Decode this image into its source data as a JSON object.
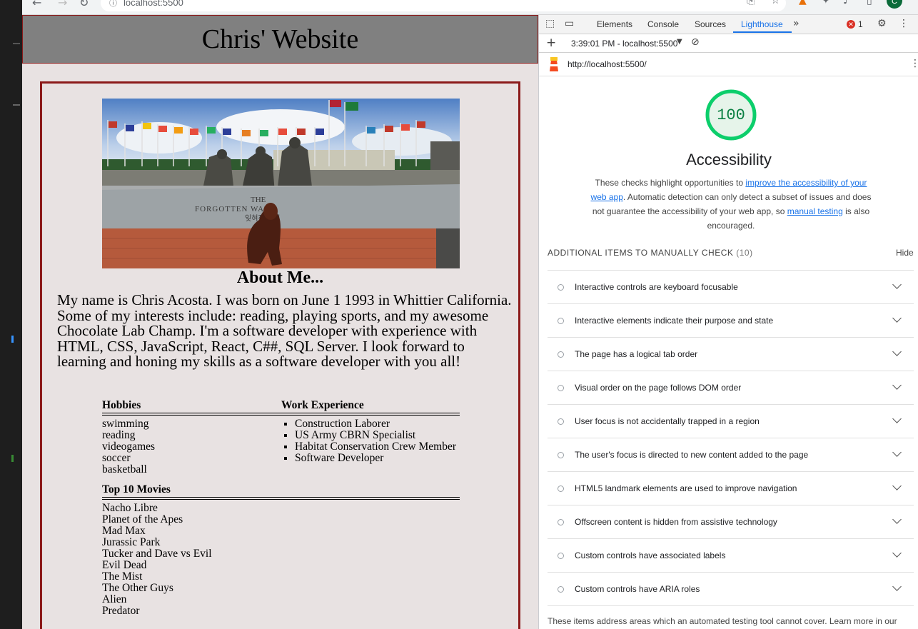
{
  "browser": {
    "address": "localhost:5500",
    "profile_initial": "C"
  },
  "site": {
    "header_title": "Chris' Website",
    "photo": {
      "inscription_line1": "THE",
      "inscription_line2": "FORGOTTEN WAR",
      "inscription_line3": "잊혀진 전쟁"
    },
    "about_title": "About Me...",
    "bio": "My name is Chris Acosta. I was born on June 1 1993 in Whittier California. Some of my interests include: reading, playing sports, and my awesome Chocolate Lab Champ. I'm a software developer with experience with HTML, CSS, JavaScript, React, C##, SQL Server. I look forward to learning and honing my skills as a software developer with you all!",
    "hobbies_title": "Hobbies",
    "hobbies": [
      "swimming",
      "reading",
      "videogames",
      "soccer",
      "basketball"
    ],
    "work_title": "Work Experience",
    "work": [
      "Construction Laborer",
      "US Army CBRN Specialist",
      "Habitat Conservation Crew Member",
      "Software Developer"
    ],
    "movies_title": "Top 10 Movies",
    "movies": [
      "Nacho Libre",
      "Planet of the Apes",
      "Mad Max",
      "Jurassic Park",
      "Tucker and Dave vs Evil",
      "Evil Dead",
      "The Mist",
      "The Other Guys",
      "Alien",
      "Predator"
    ]
  },
  "devtools": {
    "tabs": {
      "elements": "Elements",
      "console": "Console",
      "sources": "Sources",
      "lighthouse": "Lighthouse"
    },
    "error_count": "1",
    "report_select": "3:39:01 PM - localhost:5500",
    "report_url": "http://localhost:5500/",
    "score": "100",
    "score_fraction": 1.0,
    "score_color": "#0cce6b",
    "category_title": "Accessibility",
    "desc": {
      "part1": "These checks highlight opportunities to ",
      "link1": "improve the accessibility of your web app",
      "part2": ". Automatic detection can only detect a subset of issues and does not guarantee the accessibility of your web app, so ",
      "link2": "manual testing",
      "part3": " is also encouraged."
    },
    "manual_heading": "ADDITIONAL ITEMS TO MANUALLY CHECK",
    "manual_count": "(10)",
    "hide_label": "Hide",
    "audits": [
      "Interactive controls are keyboard focusable",
      "Interactive elements indicate their purpose and state",
      "The page has a logical tab order",
      "Visual order on the page follows DOM order",
      "User focus is not accidentally trapped in a region",
      "The user's focus is directed to new content added to the page",
      "HTML5 landmark elements are used to improve navigation",
      "Offscreen content is hidden from assistive technology",
      "Custom controls have associated labels",
      "Custom controls have ARIA roles"
    ],
    "footnote": "These items address areas which an automated testing tool cannot cover. Learn more in our"
  }
}
